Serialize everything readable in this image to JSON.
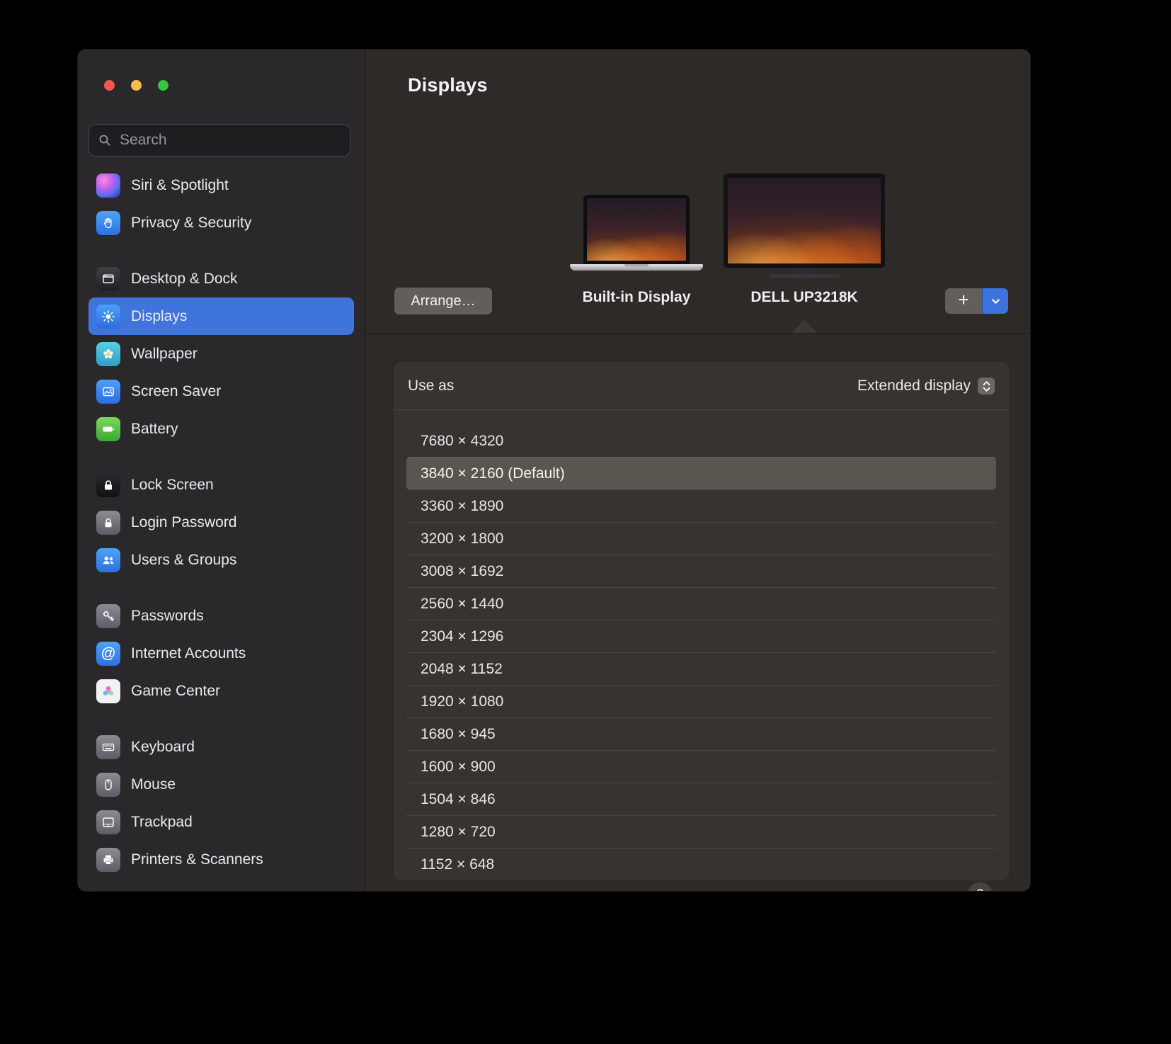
{
  "window": {
    "controls": [
      "close",
      "minimize",
      "zoom"
    ]
  },
  "sidebar": {
    "search": {
      "placeholder": "Search"
    },
    "groups": [
      {
        "items": [
          {
            "id": "siri-spotlight",
            "icon": "siri",
            "label": "Siri & Spotlight"
          },
          {
            "id": "privacy-security",
            "icon": "privacy",
            "label": "Privacy & Security"
          }
        ]
      },
      {
        "items": [
          {
            "id": "desktop-dock",
            "icon": "desktop",
            "label": "Desktop & Dock"
          },
          {
            "id": "displays",
            "icon": "displays",
            "label": "Displays",
            "selected": true
          },
          {
            "id": "wallpaper",
            "icon": "wallpaper",
            "label": "Wallpaper"
          },
          {
            "id": "screen-saver",
            "icon": "screensaver",
            "label": "Screen Saver"
          },
          {
            "id": "battery",
            "icon": "battery",
            "label": "Battery"
          }
        ]
      },
      {
        "items": [
          {
            "id": "lock-screen",
            "icon": "lock",
            "label": "Lock Screen"
          },
          {
            "id": "login-password",
            "icon": "login",
            "label": "Login Password"
          },
          {
            "id": "users-groups",
            "icon": "users",
            "label": "Users & Groups"
          }
        ]
      },
      {
        "items": [
          {
            "id": "passwords",
            "icon": "key",
            "label": "Passwords"
          },
          {
            "id": "internet-accounts",
            "icon": "at",
            "label": "Internet Accounts"
          },
          {
            "id": "game-center",
            "icon": "game",
            "label": "Game Center"
          }
        ]
      },
      {
        "items": [
          {
            "id": "keyboard",
            "icon": "keyboard",
            "label": "Keyboard"
          },
          {
            "id": "mouse",
            "icon": "mouse",
            "label": "Mouse"
          },
          {
            "id": "trackpad",
            "icon": "trackpad",
            "label": "Trackpad"
          },
          {
            "id": "printers-scanners",
            "icon": "printer",
            "label": "Printers & Scanners"
          }
        ]
      }
    ]
  },
  "header": {
    "title": "Displays",
    "arrange_button": "Arrange…",
    "displays": [
      {
        "name": "Built-in Display",
        "kind": "laptop"
      },
      {
        "name": "DELL UP3218K",
        "kind": "monitor",
        "selected": true
      }
    ],
    "add_button": "+"
  },
  "panel": {
    "use_as_label": "Use as",
    "use_as_value": "Extended display",
    "resolutions": [
      "7680 × 4320",
      "3840 × 2160 (Default)",
      "3360 × 1890",
      "3200 × 1800",
      "3008 × 1692",
      "2560 × 1440",
      "2304 × 1296",
      "2048 × 1152",
      "1920 × 1080",
      "1680 × 945",
      "1600 × 900",
      "1504 × 846",
      "1280 × 720",
      "1152 × 648"
    ],
    "selected_resolution_index": 1,
    "help_label": "?"
  },
  "colors": {
    "accent_blue": "#3d73dd",
    "sidebar_selected": "#3f74dc",
    "selected_row": "#5a554f"
  }
}
